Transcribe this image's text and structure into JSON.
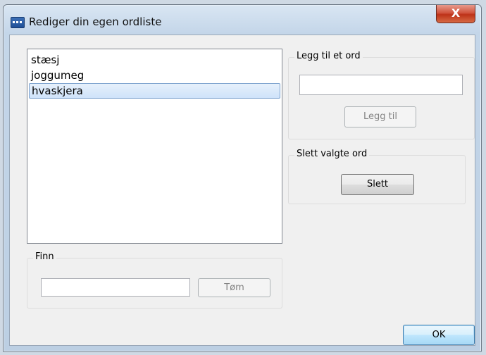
{
  "window": {
    "title": "Rediger din egen ordliste",
    "close_glyph": "X"
  },
  "word_list": {
    "items": [
      "stæsj",
      "joggumeg",
      "hvaskjera"
    ],
    "selected_index": 2
  },
  "add_group": {
    "label": "Legg til et ord",
    "input_value": "",
    "button_label": "Legg til"
  },
  "delete_group": {
    "label": "Slett valgte ord",
    "button_label": "Slett"
  },
  "find_group": {
    "label": "Finn",
    "input_value": "",
    "button_label": "Tøm"
  },
  "footer": {
    "ok_label": "OK"
  },
  "icons": {
    "app": "dictionary-app-icon",
    "close": "close-icon"
  }
}
